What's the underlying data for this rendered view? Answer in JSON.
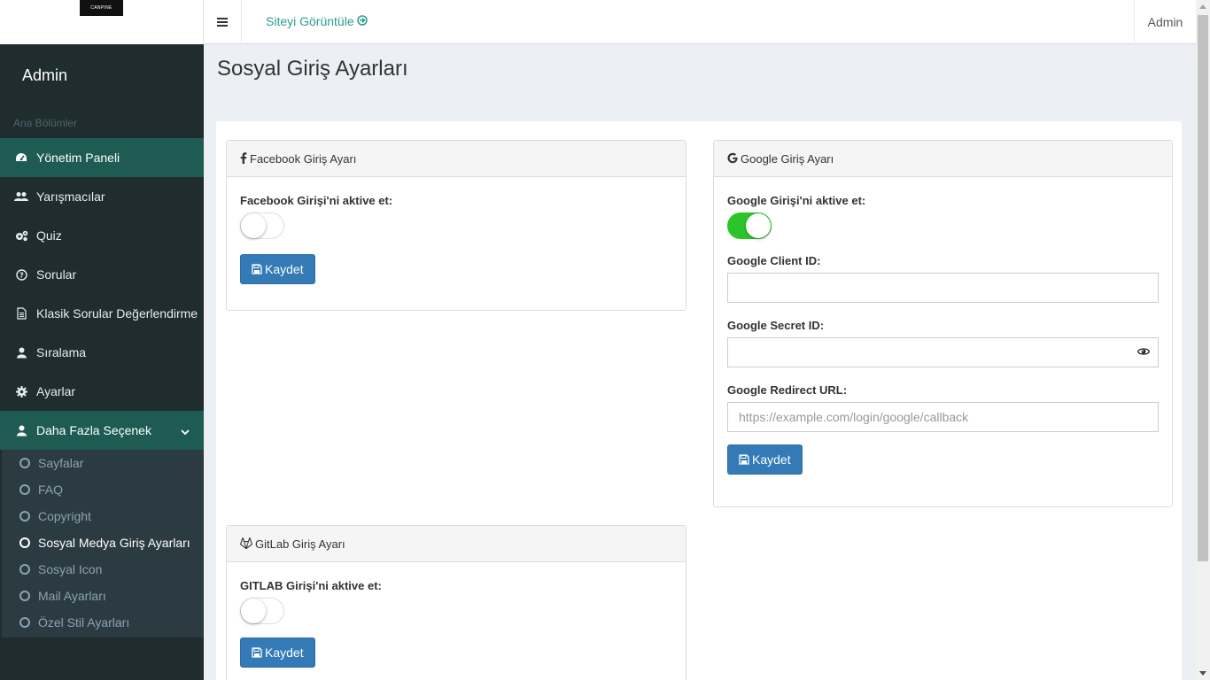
{
  "brand": {
    "logo_text": "CANPINE"
  },
  "sidebar": {
    "user": "Admin",
    "section": "Ana Bölümler",
    "items": [
      {
        "label": "Yönetim Paneli",
        "icon": "dashboard-icon"
      },
      {
        "label": "Yarışmacılar",
        "icon": "users-icon"
      },
      {
        "label": "Quiz",
        "icon": "cogs-icon"
      },
      {
        "label": "Sorular",
        "icon": "question-circle-icon"
      },
      {
        "label": "Klasik Sorular Değerlendirme",
        "icon": "file-text-icon"
      },
      {
        "label": "Sıralama",
        "icon": "user-icon"
      },
      {
        "label": "Ayarlar",
        "icon": "gear-icon"
      },
      {
        "label": "Daha Fazla Seçenek",
        "icon": "user-icon"
      }
    ],
    "subitems": [
      "Sayfalar",
      "FAQ",
      "Copyright",
      "Sosyal Medya Giriş Ayarları",
      "Sosyal Icon",
      "Mail Ayarları",
      "Özel Stil Ayarları"
    ]
  },
  "header": {
    "site_link": "Siteyi Görüntüle",
    "user": "Admin"
  },
  "page": {
    "title": "Sosyal Giriş Ayarları"
  },
  "facebook": {
    "title": "Facebook Giriş Ayarı",
    "toggle_label": "Facebook Girişi'ni aktive et:",
    "enabled": false,
    "save": "Kaydet"
  },
  "google": {
    "title": "Google Giriş Ayarı",
    "toggle_label": "Google Girişi'ni aktive et:",
    "enabled": true,
    "client_id_label": "Google Client ID:",
    "client_id_value": "",
    "secret_label": "Google Secret ID:",
    "secret_value": "",
    "redirect_label": "Google Redirect URL:",
    "redirect_placeholder": "https://example.com/login/google/callback",
    "save": "Kaydet"
  },
  "gitlab": {
    "title": "GitLab Giriş Ayarı",
    "toggle_label": "GITLAB Girişi'ni aktive et:",
    "enabled": false,
    "save": "Kaydet"
  },
  "colors": {
    "sidebar_bg": "#1f2d2e",
    "active_item": "#1e5c53",
    "link": "#2a9d8f",
    "primary_button": "#337ab7",
    "switch_on": "#2bc42b"
  }
}
